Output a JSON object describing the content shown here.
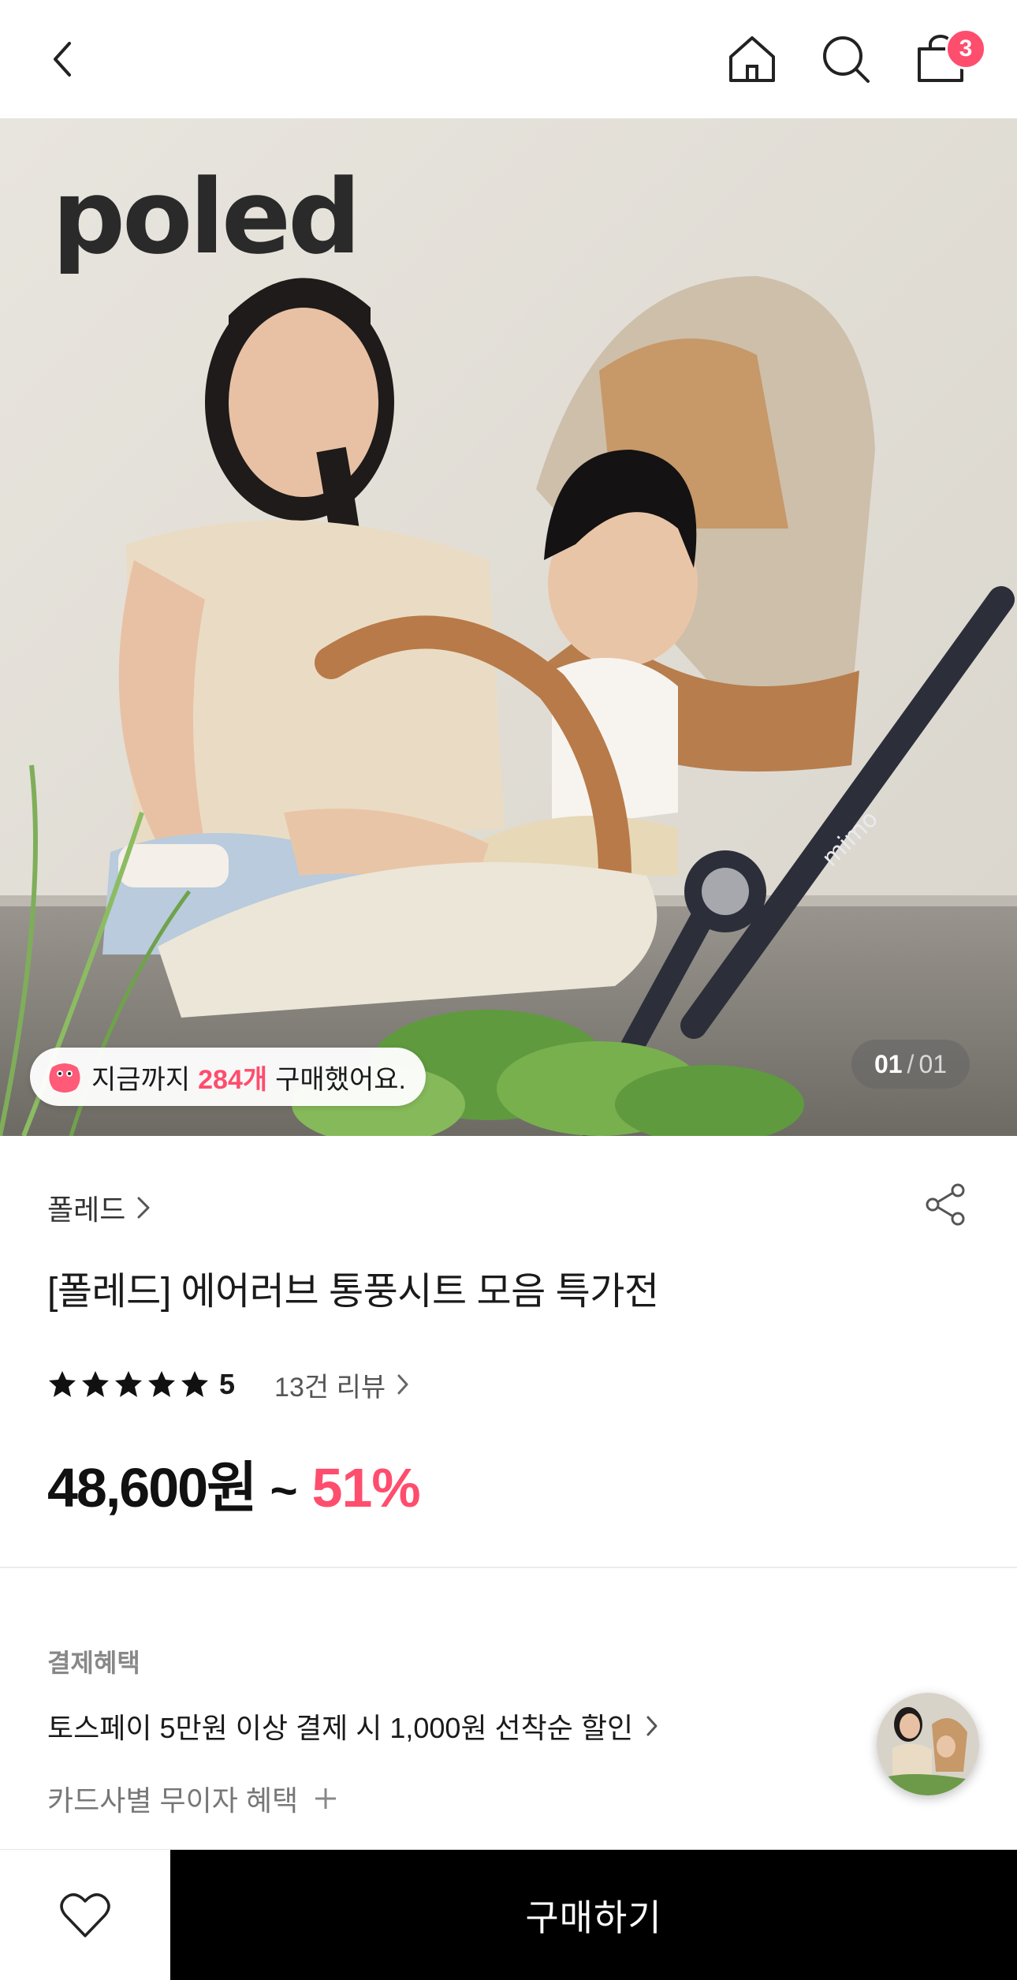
{
  "header": {
    "cart_count": "3",
    "icons": [
      "chevron-left-icon",
      "home-icon",
      "search-icon",
      "shopping-bag-icon"
    ]
  },
  "hero": {
    "brand_logo": "poled",
    "stroller_print": "mimo",
    "purchase_pill": {
      "prefix": "지금까지",
      "count": "284개",
      "suffix": "구매했어요."
    },
    "counter": {
      "current": "01",
      "separator": "/",
      "total": "01"
    }
  },
  "product": {
    "brand": "폴레드",
    "title": "[폴레드] 에어러브 통풍시트 모음 특가전",
    "rating": "5",
    "stars": 5,
    "review_link": "13건 리뷰",
    "price": "48,600원",
    "price_tilde": "~",
    "discount": "51%"
  },
  "benefits": {
    "heading": "결제혜택",
    "toss": "토스페이 5만원 이상 결제 시 1,000원 선착순 할인",
    "card": "카드사별 무이자 혜택"
  },
  "bottom": {
    "buy_label": "구매하기"
  },
  "colors": {
    "accent": "#ff4d6d",
    "buy_bg": "#000000",
    "divider": "#ececec"
  }
}
